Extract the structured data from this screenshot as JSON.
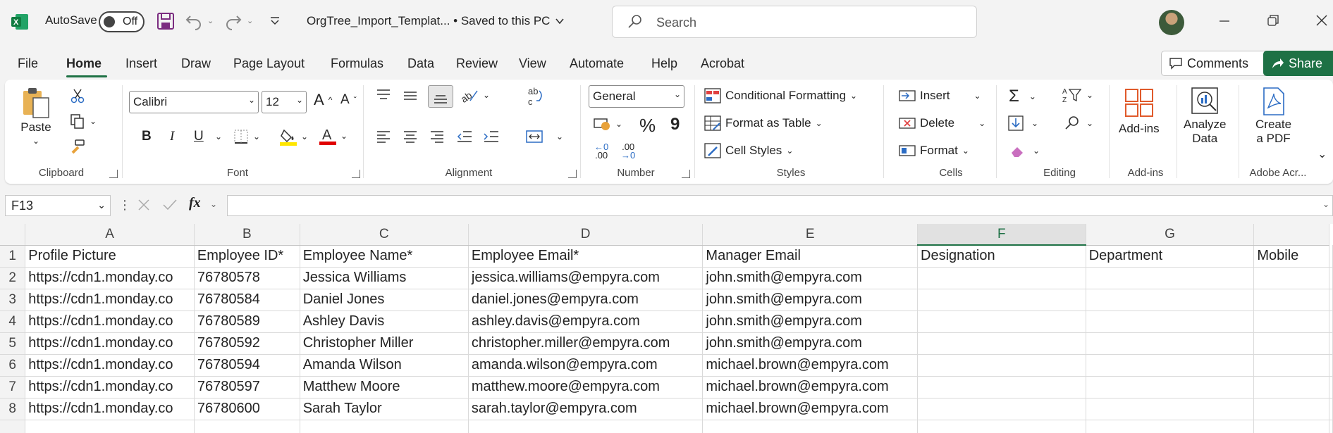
{
  "titlebar": {
    "autosave_label": "AutoSave",
    "autosave_state": "Off",
    "document_title": "OrgTree_Import_Templat...  • Saved to this PC",
    "search_placeholder": "Search"
  },
  "tabs": [
    "File",
    "Home",
    "Insert",
    "Draw",
    "Page Layout",
    "Formulas",
    "Data",
    "Review",
    "View",
    "Automate",
    "Help",
    "Acrobat"
  ],
  "active_tab": "Home",
  "comments_label": "Comments",
  "share_label": "Share",
  "ribbon": {
    "clipboard": {
      "paste": "Paste",
      "label": "Clipboard"
    },
    "font": {
      "name": "Calibri",
      "size": "12",
      "label": "Font",
      "bold": "B",
      "italic": "I",
      "underline": "U",
      "grow": "A",
      "shrink": "A"
    },
    "alignment": {
      "label": "Alignment"
    },
    "number": {
      "format": "General",
      "percent": "%",
      "comma": "9",
      "label": "Number",
      "inc_dec": ".00",
      "dec_dec": ".00"
    },
    "styles": {
      "conditional": "Conditional Formatting",
      "format_table": "Format as Table",
      "cell_styles": "Cell Styles",
      "label": "Styles"
    },
    "cells": {
      "insert": "Insert",
      "delete": "Delete",
      "format": "Format",
      "label": "Cells"
    },
    "editing": {
      "label": "Editing"
    },
    "addins": {
      "button": "Add-ins",
      "label": "Add-ins"
    },
    "analyze": {
      "line1": "Analyze",
      "line2": "Data"
    },
    "acrobat": {
      "line1": "Create",
      "line2": "a PDF",
      "label": "Adobe Acr..."
    }
  },
  "formula_bar": {
    "name_box": "F13",
    "fx": "fx"
  },
  "sheet": {
    "columns": [
      "A",
      "B",
      "C",
      "D",
      "E",
      "F",
      "G",
      ""
    ],
    "selected_column": "F",
    "rows": [
      [
        "Profile Picture",
        "Employee ID*",
        "Employee Name*",
        "Employee Email*",
        "Manager Email",
        "Designation",
        "Department",
        "Mobile"
      ],
      [
        "https://cdn1.monday.co",
        "76780578",
        "Jessica Williams",
        "jessica.williams@empyra.com",
        "john.smith@empyra.com",
        "",
        "",
        ""
      ],
      [
        "https://cdn1.monday.co",
        "76780584",
        "Daniel Jones",
        "daniel.jones@empyra.com",
        "john.smith@empyra.com",
        "",
        "",
        ""
      ],
      [
        "https://cdn1.monday.co",
        "76780589",
        "Ashley Davis",
        "ashley.davis@empyra.com",
        "john.smith@empyra.com",
        "",
        "",
        ""
      ],
      [
        "https://cdn1.monday.co",
        "76780592",
        "Christopher Miller",
        "christopher.miller@empyra.com",
        "john.smith@empyra.com",
        "",
        "",
        ""
      ],
      [
        "https://cdn1.monday.co",
        "76780594",
        "Amanda Wilson",
        "amanda.wilson@empyra.com",
        "michael.brown@empyra.com",
        "",
        "",
        ""
      ],
      [
        "https://cdn1.monday.co",
        "76780597",
        "Matthew Moore",
        "matthew.moore@empyra.com",
        "michael.brown@empyra.com",
        "",
        "",
        ""
      ],
      [
        "https://cdn1.monday.co",
        "76780600",
        "Sarah Taylor",
        "sarah.taylor@empyra.com",
        "michael.brown@empyra.com",
        "",
        "",
        ""
      ]
    ]
  },
  "colors": {
    "accent": "#1e7145",
    "font_color": "#e00000",
    "highlight": "#ffe600"
  }
}
